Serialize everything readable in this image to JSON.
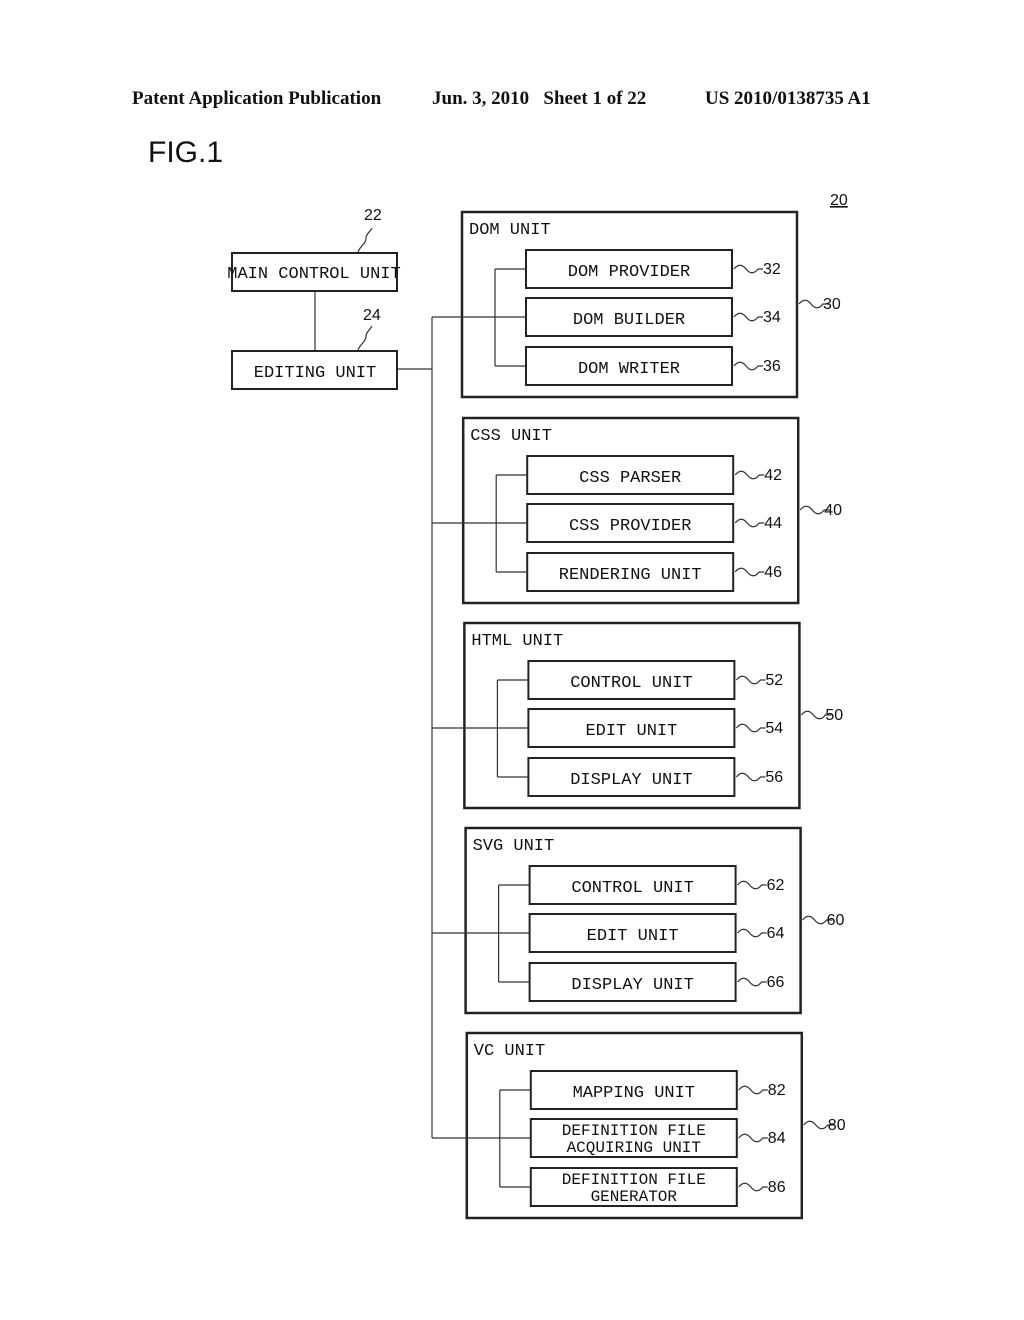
{
  "header": {
    "publication": "Patent Application Publication",
    "date_sheet": "Jun. 3, 2010   Sheet 1 of 22",
    "number": "US 2010/0138735 A1"
  },
  "figure": {
    "title": "FIG.1",
    "system_ref": "20",
    "main_control": {
      "label": "MAIN CONTROL UNIT",
      "ref": "22"
    },
    "editing": {
      "label": "EDITING UNIT",
      "ref": "24"
    },
    "groups": [
      {
        "title": "DOM UNIT",
        "ref": "30",
        "items": [
          {
            "label": "DOM PROVIDER",
            "ref": "32"
          },
          {
            "label": "DOM BUILDER",
            "ref": "34"
          },
          {
            "label": "DOM WRITER",
            "ref": "36"
          }
        ]
      },
      {
        "title": "CSS UNIT",
        "ref": "40",
        "items": [
          {
            "label": "CSS PARSER",
            "ref": "42"
          },
          {
            "label": "CSS PROVIDER",
            "ref": "44"
          },
          {
            "label": "RENDERING UNIT",
            "ref": "46"
          }
        ]
      },
      {
        "title": "HTML UNIT",
        "ref": "50",
        "items": [
          {
            "label": "CONTROL UNIT",
            "ref": "52"
          },
          {
            "label": "EDIT UNIT",
            "ref": "54"
          },
          {
            "label": "DISPLAY UNIT",
            "ref": "56"
          }
        ]
      },
      {
        "title": "SVG UNIT",
        "ref": "60",
        "items": [
          {
            "label": "CONTROL UNIT",
            "ref": "62"
          },
          {
            "label": "EDIT UNIT",
            "ref": "64"
          },
          {
            "label": "DISPLAY UNIT",
            "ref": "66"
          }
        ]
      },
      {
        "title": "VC UNIT",
        "ref": "80",
        "items": [
          {
            "label": "MAPPING UNIT",
            "ref": "82"
          },
          {
            "label": "DEFINITION FILE\nACQUIRING UNIT",
            "ref": "84"
          },
          {
            "label": "DEFINITION FILE\nGENERATOR",
            "ref": "86"
          }
        ]
      }
    ]
  }
}
